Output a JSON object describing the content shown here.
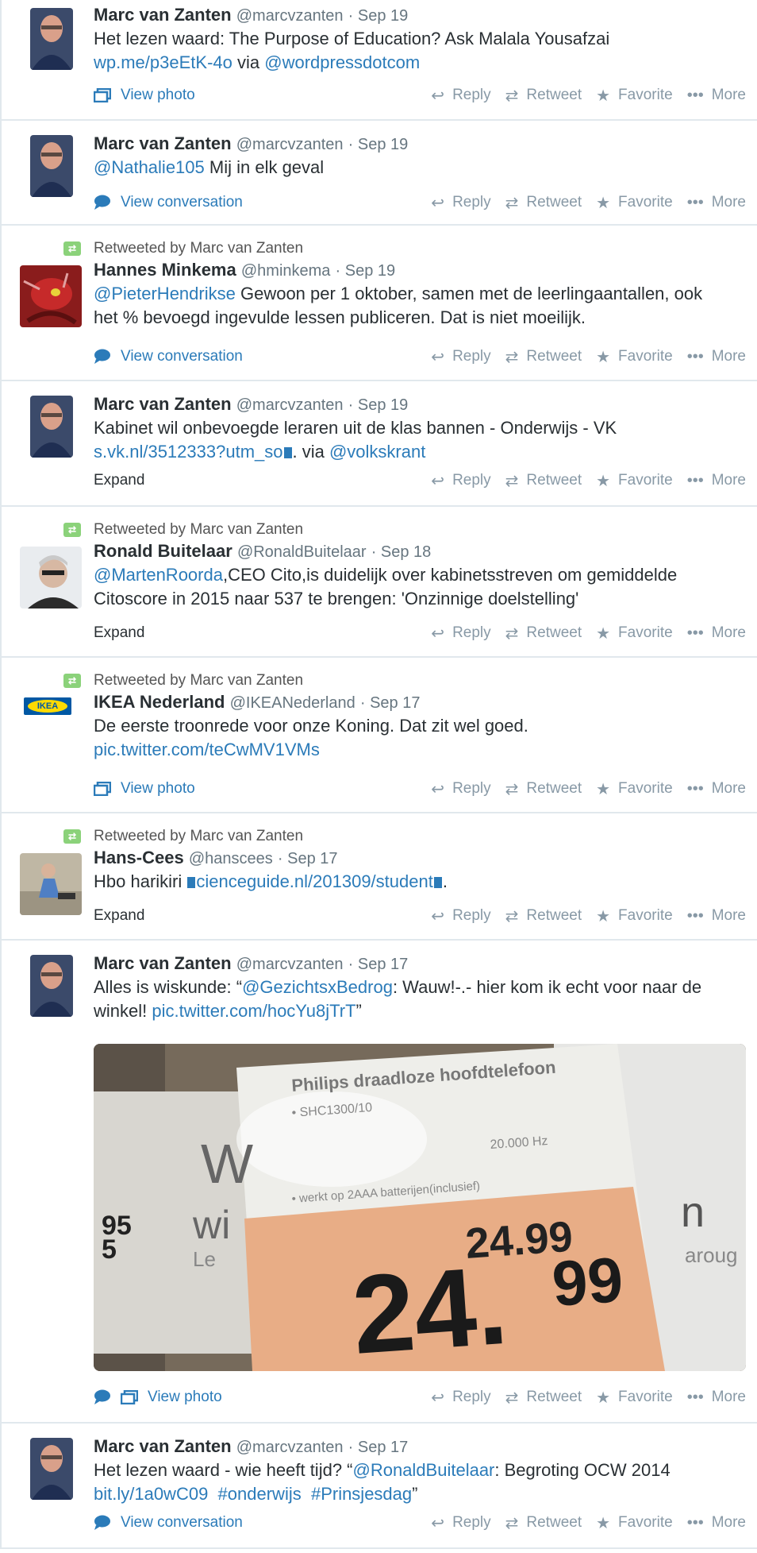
{
  "tweets": [
    {
      "retweeted_by": "",
      "name": "Marc van Zanten",
      "handle": "@marcvzanten",
      "date": "· Sep 19",
      "text_plain_1": "Het lezen waard: The Purpose of Education? Ask Malala Yousafzai",
      "link_1": "wp.me/p3eEtK-4o",
      "text_plain_2": " via ",
      "link_2": "@wordpressdotcom",
      "left_action": "View photo"
    },
    {
      "retweeted_by": "",
      "name": "Marc van Zanten",
      "handle": "@marcvzanten",
      "date": "· Sep 19",
      "link_1": "@Nathalie105",
      "text_plain_1": " Mij in elk geval",
      "left_action": "View conversation"
    },
    {
      "retweeted_by": "Retweeted by Marc van Zanten",
      "name": "Hannes Minkema",
      "handle": "@hminkema",
      "date": "· Sep 19",
      "link_1": "@PieterHendrikse",
      "text_plain_1": " Gewoon per 1 oktober, samen met de leerlingaantallen, ook",
      "text_plain_2": "het % bevoegd ingevulde lessen publiceren. Dat is niet moeilijk.",
      "left_action": "View conversation"
    },
    {
      "retweeted_by": "",
      "name": "Marc van Zanten",
      "handle": "@marcvzanten",
      "date": "· Sep 19",
      "text_plain_1": "Kabinet wil onbevoegde leraren uit de klas bannen - Onderwijs - VK",
      "link_1": "s.vk.nl/3512333?utm_so",
      "text_plain_2": ". via ",
      "link_2": "@volkskrant",
      "left_action": "Expand"
    },
    {
      "retweeted_by": "Retweeted by Marc van Zanten",
      "name": "Ronald Buitelaar",
      "handle": "@RonaldBuitelaar",
      "date": "· Sep 18",
      "link_1": "@MartenRoorda",
      "text_plain_1": ",CEO Cito,is duidelijk over kabinetsstreven om gemiddelde",
      "text_plain_2": "Citoscore in 2015 naar 537 te brengen: 'Onzinnige doelstelling'",
      "left_action": "Expand"
    },
    {
      "retweeted_by": "Retweeted by Marc van Zanten",
      "name": "IKEA Nederland",
      "handle": "@IKEANederland",
      "date": "· Sep 17",
      "text_plain_1": "De eerste troonrede voor onze Koning. Dat zit wel goed.",
      "link_1": "pic.twitter.com/teCwMV1VMs",
      "left_action": "View photo",
      "logo_text": "IKEA"
    },
    {
      "retweeted_by": "Retweeted by Marc van Zanten",
      "name": "Hans-Cees",
      "handle": "@hanscees",
      "date": "· Sep 17",
      "text_plain_1": "Hbo harikiri ",
      "link_1": "cienceguide.nl/201309/student",
      "text_plain_2": ".",
      "left_action": "Expand"
    },
    {
      "retweeted_by": "",
      "name": "Marc van Zanten",
      "handle": "@marcvzanten",
      "date": "· Sep 17",
      "text_plain_1": "Alles is wiskunde: “",
      "link_1": "@GezichtsxBedrog",
      "text_plain_2": ": Wauw!-.- hier kom ik echt voor naar de",
      "text_plain_3": "winkel! ",
      "link_2": "pic.twitter.com/hocYu8jTrT",
      "text_plain_4": "”",
      "left_action": "View photo",
      "photo": {
        "heading": "Philips draadloze hoofdtelefoon",
        "line1": "• SHC1300/10",
        "line2": "20.000 Hz",
        "line3": "• werkt op 2AAA batterijen(inclusief)",
        "price_small": "24.99",
        "price_big_main": "24.",
        "price_big_cents": "99",
        "side_letters": "W",
        "side_letters_2": "wi",
        "side_num_1": "95",
        "side_num_2": "5",
        "side_le": "Le",
        "right_n": "n",
        "right_text": "aroug"
      }
    },
    {
      "retweeted_by": "",
      "name": "Marc van Zanten",
      "handle": "@marcvzanten",
      "date": "· Sep 17",
      "text_plain_1": "Het lezen waard - wie heeft tijd? “",
      "link_1": "@RonaldBuitelaar",
      "text_plain_2": ": Begroting OCW 2014",
      "link_2": "bit.ly/1a0wC09",
      "link_3": "#onderwijs",
      "link_4": "#Prinsjesdag",
      "text_plain_3": "”",
      "left_action": "View conversation"
    }
  ],
  "actions": {
    "reply": "Reply",
    "retweet": "Retweet",
    "favorite": "Favorite",
    "more": "More"
  },
  "colors": {
    "link": "#2b7bb9",
    "muted": "#8899a6",
    "retweet_badge": "#8bd27a",
    "divider": "#e1e8ed"
  }
}
